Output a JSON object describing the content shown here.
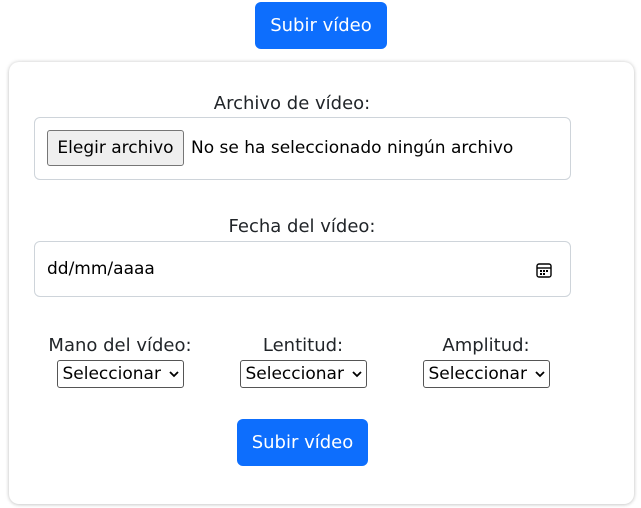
{
  "top_button": {
    "label": "Subir vídeo"
  },
  "form": {
    "file_label": "Archivo de vídeo:",
    "choose_file_label": "Elegir archivo",
    "file_status": "No se ha seleccionado ningún archivo",
    "date_label": "Fecha del vídeo:",
    "date_placeholder": "dd/mm/aaaa",
    "selects": [
      {
        "label": "Mano del vídeo:",
        "value": "Seleccionar"
      },
      {
        "label": "Lentitud:",
        "value": "Seleccionar"
      },
      {
        "label": "Amplitud:",
        "value": "Seleccionar"
      }
    ],
    "submit_label": "Subir vídeo"
  },
  "colors": {
    "primary": "#0d6efd",
    "border": "#ced4da"
  },
  "icons": {
    "date": "calendar-icon",
    "select": "chevron-down-icon"
  }
}
